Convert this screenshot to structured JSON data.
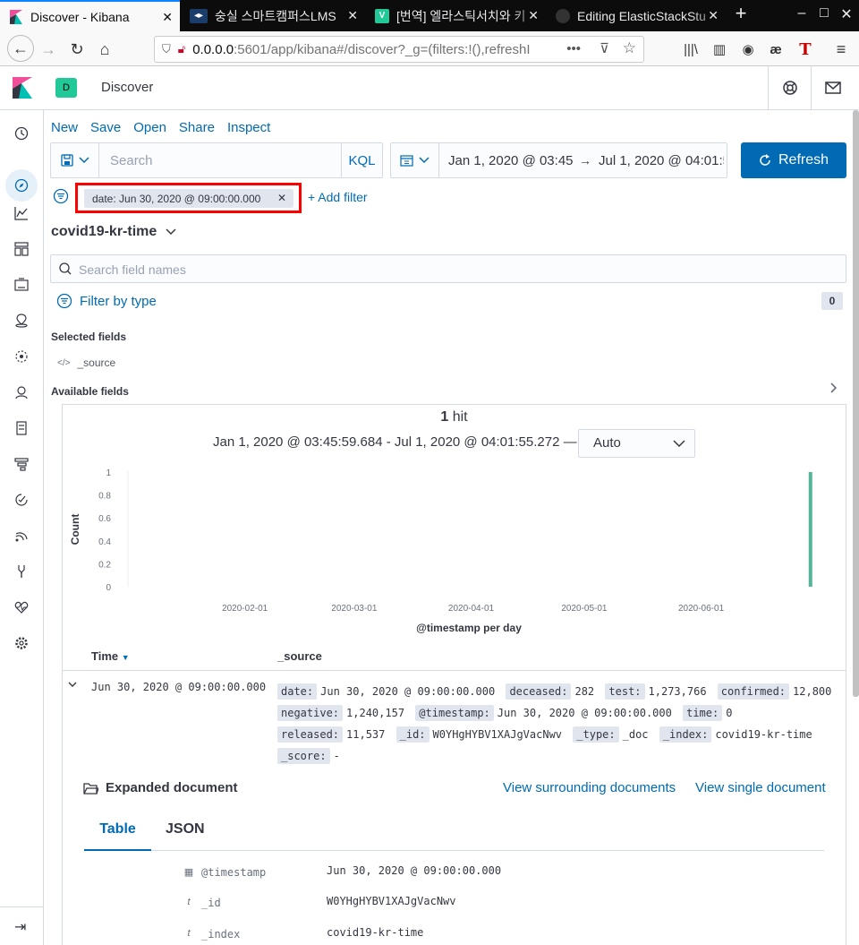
{
  "browser": {
    "tabs": [
      {
        "title": "Discover - Kibana",
        "active": true
      },
      {
        "title": "숭실 스마트캠퍼스LMS",
        "active": false
      },
      {
        "title": "[번역] 엘라스틱서치와 키",
        "active": false
      },
      {
        "title": "Editing ElasticStackStu",
        "active": false
      }
    ],
    "url_host": "0.0.0.0",
    "url_rest": ":5601/app/kibana#/discover?_g=(filters:!(),refreshI"
  },
  "header": {
    "space_initial": "D",
    "breadcrumb": "Discover"
  },
  "top_menu": [
    "New",
    "Save",
    "Open",
    "Share",
    "Inspect"
  ],
  "query": {
    "placeholder": "Search",
    "language": "KQL"
  },
  "time": {
    "start": "Jan 1, 2020 @ 03:45:59.684",
    "end": "Jul 1, 2020 @ 04:01:55.272",
    "refresh_label": "Refresh"
  },
  "filter": {
    "pill": "date: Jun 30, 2020 @ 09:00:00.000",
    "add_label": "+ Add filter"
  },
  "sidebar": {
    "index_pattern": "covid19-kr-time",
    "field_search_placeholder": "Search field names",
    "filter_by_type": "Filter by type",
    "filter_count": "0",
    "selected_fields_label": "Selected fields",
    "selected_fields": [
      "_source"
    ],
    "available_fields_label": "Available fields"
  },
  "results": {
    "hit_count": "1",
    "hit_word": "hit",
    "range_text": "Jan 1, 2020 @ 03:45:59.684 - Jul 1, 2020 @ 04:01:55.272 —",
    "interval": "Auto"
  },
  "chart_data": {
    "type": "bar",
    "ylabel": "Count",
    "xlabel": "@timestamp per day",
    "ylim": [
      0,
      1
    ],
    "yticks": [
      "0",
      "0.2",
      "0.4",
      "0.6",
      "0.8",
      "1"
    ],
    "xticks": [
      "2020-02-01",
      "2020-03-01",
      "2020-04-01",
      "2020-05-01",
      "2020-06-01"
    ],
    "x": [
      "2020-06-30"
    ],
    "values": [
      1
    ],
    "color": "#54b399",
    "grid": false
  },
  "table": {
    "col_time": "Time",
    "col_source": "_source",
    "row": {
      "time": "Jun 30, 2020 @ 09:00:00.000",
      "source": [
        {
          "k": "date:",
          "v": "Jun 30, 2020 @ 09:00:00.000"
        },
        {
          "k": "deceased:",
          "v": "282"
        },
        {
          "k": "test:",
          "v": "1,273,766"
        },
        {
          "k": "confirmed:",
          "v": "12,800"
        },
        {
          "k": "negative:",
          "v": "1,240,157"
        },
        {
          "k": "@timestamp:",
          "v": "Jun 30, 2020 @ 09:00:00.000"
        },
        {
          "k": "time:",
          "v": "0"
        },
        {
          "k": "released:",
          "v": "11,537"
        },
        {
          "k": "_id:",
          "v": "W0YHgHYBV1XAJgVacNwv"
        },
        {
          "k": "_type:",
          "v": "_doc"
        },
        {
          "k": "_index:",
          "v": "covid19-kr-time"
        },
        {
          "k": "_score:",
          "v": "-"
        }
      ]
    }
  },
  "expanded": {
    "title": "Expanded document",
    "view_surrounding": "View surrounding documents",
    "view_single": "View single document",
    "tab_table": "Table",
    "tab_json": "JSON",
    "rows": [
      {
        "icon": "▦",
        "field": "@timestamp",
        "value": "Jun 30, 2020 @ 09:00:00.000"
      },
      {
        "icon": "t",
        "field": "_id",
        "value": "W0YHgHYBV1XAJgVacNwv"
      },
      {
        "icon": "t",
        "field": "_index",
        "value": "covid19-kr-time"
      }
    ]
  }
}
